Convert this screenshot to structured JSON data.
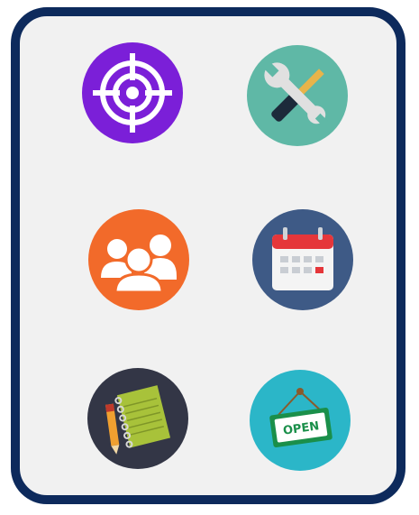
{
  "icons": [
    {
      "name": "target-icon",
      "color": "#7b1fd8"
    },
    {
      "name": "tools-icon",
      "color": "#5fb8a6"
    },
    {
      "name": "group-icon",
      "color": "#f26a2a"
    },
    {
      "name": "calendar-icon",
      "color": "#3e5a86"
    },
    {
      "name": "notebook-icon",
      "color": "#333646"
    },
    {
      "name": "open-sign-icon",
      "color": "#2bb6c8"
    }
  ],
  "sign": {
    "label": "OPEN"
  },
  "colors": {
    "frame": "#0d2a5c",
    "panel": "#f1f1f1"
  }
}
